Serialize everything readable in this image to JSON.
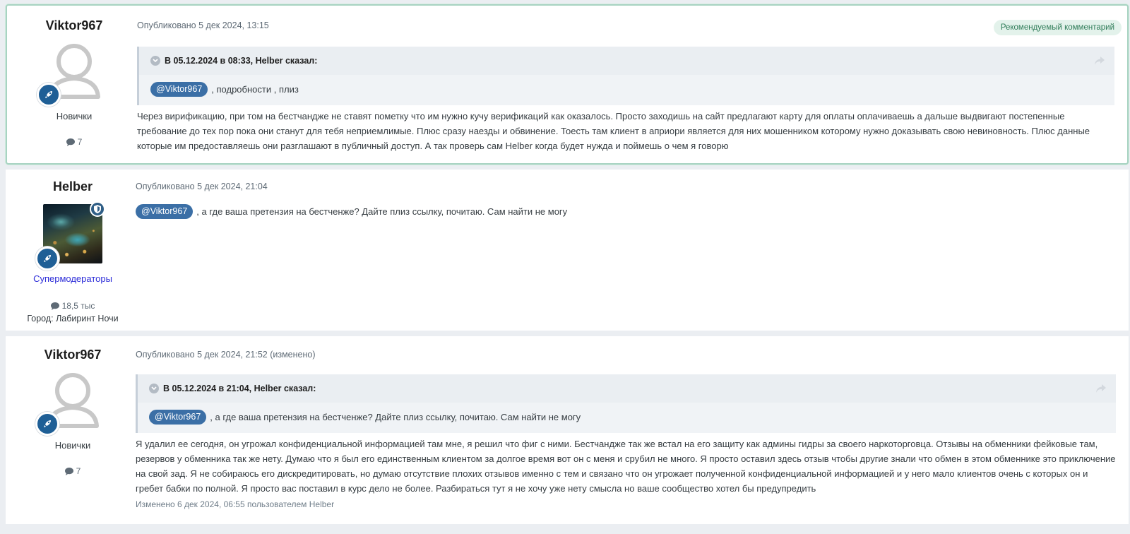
{
  "posts": [
    {
      "author": "Viktor967",
      "group": "Новички",
      "posts_count": "7",
      "meta": "Опубликовано 5 дек 2024, 13:15",
      "badge": "Рекомендуемый комментарий",
      "quote": {
        "header": "В 05.12.2024 в 08:33, Helber сказал:",
        "mention": "@Viktor967",
        "text": ", подробности , плиз"
      },
      "body": "Через вирификацию, при том на бестчандже не ставят пометку что им нужно кучу верификаций как оказалось. Просто заходишь на сайт  предлагают карту для оплаты оплачиваешь а дальше выдвигают постепенные требование до тех пор пока они станут для тебя неприемлимые. Плюс сразу наезды и обвинение. Тоесть там клиент в априори является для них мошенником которому нужно доказывать свою невиновность. Плюс данные которые им предоставляешь они разглашают в публичный доступ. А так проверь сам Helber когда будет нужда и поймешь о чем я говорю"
    },
    {
      "author": "Helber",
      "group": "Супермодераторы",
      "posts_count": "18,5 тыс",
      "city": "Город: Лабиринт Ночи",
      "meta": "Опубликовано 5 дек 2024, 21:04",
      "mention": "@Viktor967",
      "body": ", а где ваша претензия на бестченже? Дайте плиз ссылку, почитаю. Сам найти не могу"
    },
    {
      "author": "Viktor967",
      "group": "Новички",
      "posts_count": "7",
      "meta": "Опубликовано 5 дек 2024, 21:52 (изменено)",
      "quote": {
        "header": "В 05.12.2024 в 21:04, Helber сказал:",
        "mention": "@Viktor967",
        "text": ", а где ваша претензия на бестченже? Дайте плиз ссылку, почитаю. Сам найти не могу"
      },
      "body": "Я удалил ее сегодня, он угрожал конфиденциальной информацией там мне, я решил что фиг с ними. Бестчандже так же встал на его защиту как админы гидры за своего наркоторговца. Отзывы на обменники фейковые там, резервов у обменника так же нету. Думаю что я был его единственным клиентом за долгое время вот он с меня и срубил не много. Я просто оставил здесь отзыв чтобы другие знали что обмен в этом обменнике это приключение на свой зад. Я не собираюсь его дискредитировать, но думаю отсутствие плохих отзывов именно с тем и связано что он угрожает полученной конфиденциальной информацией и у него мало клиентов очень с которых он и гребет бабки по полной. Я просто вас поставил в курс дело не более. Разбираться тут я не хочу уже нету смысла но ваше сообщество хотел бы предупредить",
      "edited": "Изменено 6 дек 2024, 06:55 пользователем Helber"
    }
  ],
  "colors": {
    "mention_bg": "#3b6fa6",
    "rocket_badge": "#1f5f96",
    "moderator_link": "#2c2cd8",
    "recommended_border": "#a8d3c2"
  },
  "icons": [
    "rocket-icon",
    "shield-icon",
    "comment-icon",
    "chevron-down-icon",
    "share-icon",
    "default-avatar-icon"
  ]
}
